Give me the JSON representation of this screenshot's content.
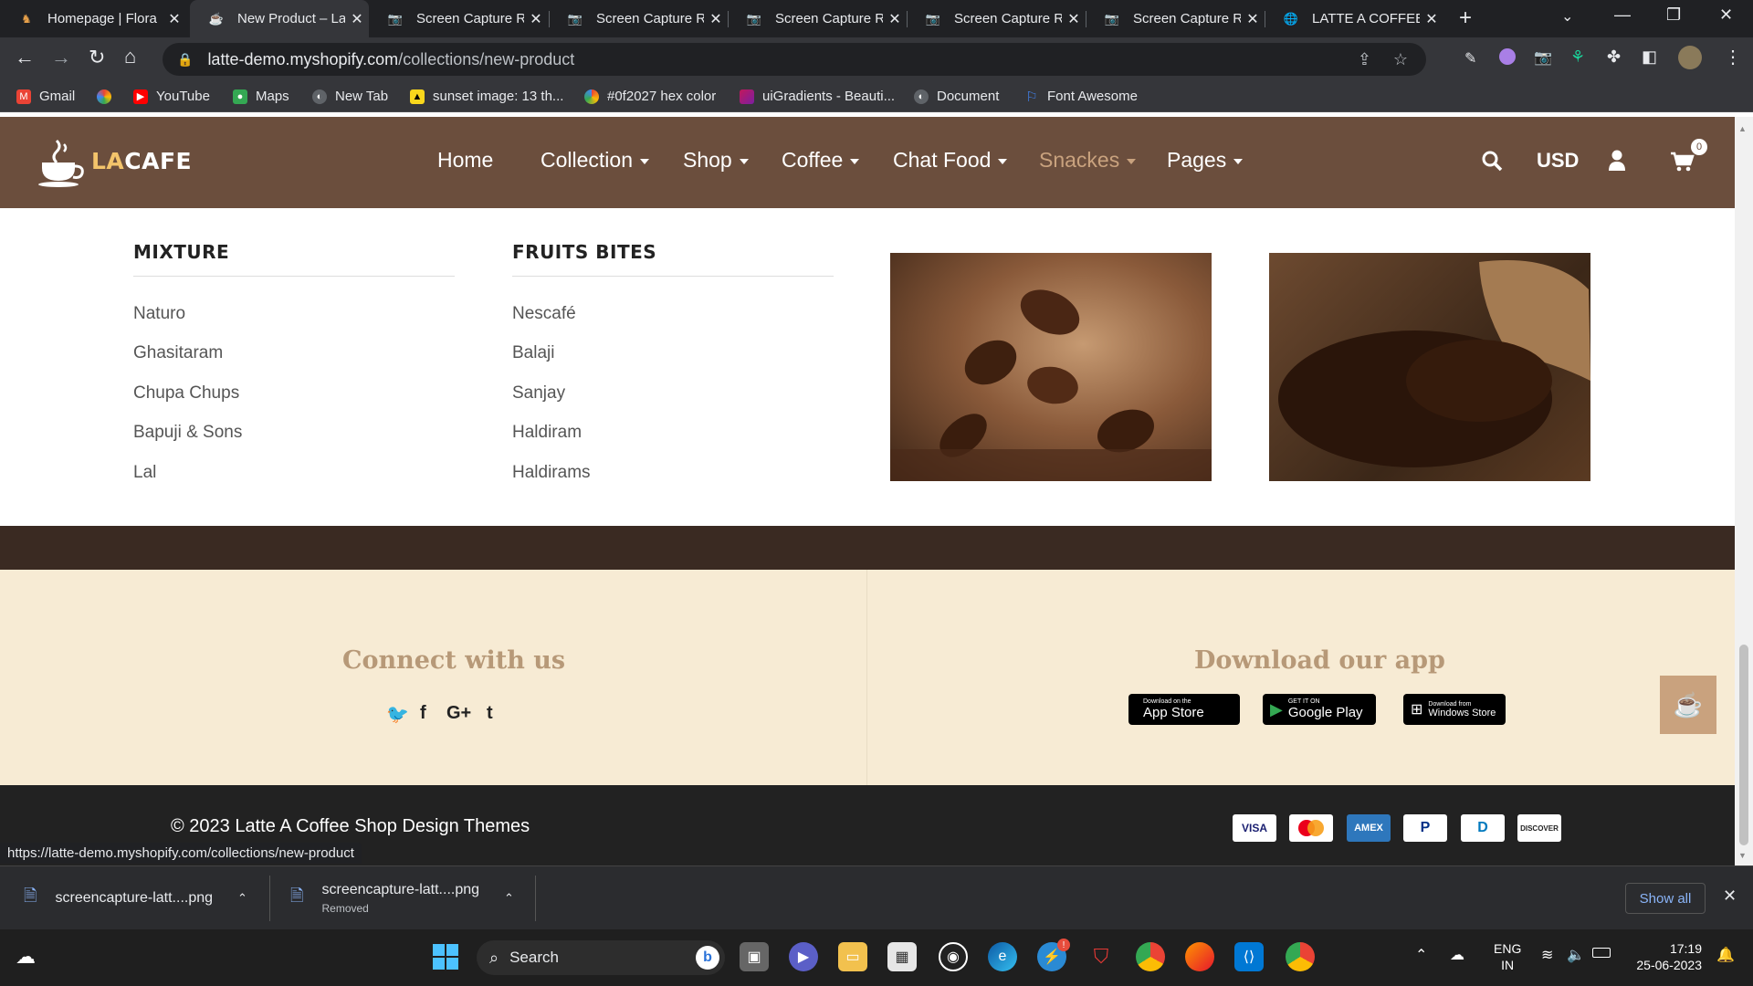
{
  "browser": {
    "tabs": [
      {
        "title": "Homepage | Flora",
        "active": false
      },
      {
        "title": "New Product – Latte",
        "active": true
      },
      {
        "title": "Screen Capture R",
        "active": false
      },
      {
        "title": "Screen Capture R",
        "active": false
      },
      {
        "title": "Screen Capture R",
        "active": false
      },
      {
        "title": "Screen Capture R",
        "active": false
      },
      {
        "title": "Screen Capture R",
        "active": false
      },
      {
        "title": "LATTE A COFFEE S",
        "active": false
      }
    ],
    "url_domain": "latte-demo.myshopify.com",
    "url_path": "/collections/new-product",
    "bookmarks": [
      {
        "label": "Gmail",
        "icon": "gmail-icon",
        "color": "#ea4335"
      },
      {
        "label": "",
        "icon": "colorful-circle-icon",
        "color": "#f4b400"
      },
      {
        "label": "YouTube",
        "icon": "youtube-icon",
        "color": "#ff0000"
      },
      {
        "label": "Maps",
        "icon": "maps-pin-icon",
        "color": "#34a853"
      },
      {
        "label": "New Tab",
        "icon": "globe-icon",
        "color": "#9aa0a6"
      },
      {
        "label": "sunset image: 13 th...",
        "icon": "image-icon",
        "color": "#f9d71c"
      },
      {
        "label": "#0f2027 hex color",
        "icon": "color-icon",
        "color": "#4285f4"
      },
      {
        "label": "uiGradients - Beauti...",
        "icon": "gradient-icon",
        "color": "#c2185b"
      },
      {
        "label": "Document",
        "icon": "globe-icon",
        "color": "#9aa0a6"
      },
      {
        "label": "Font Awesome",
        "icon": "flag-icon",
        "color": "#4285f4"
      }
    ],
    "status_url": "https://latte-demo.myshopify.com/collections/new-product"
  },
  "site": {
    "logo_text_1": "LA",
    "logo_text_2": "CAFE",
    "nav": [
      {
        "label": "Home",
        "dropdown": false,
        "active": false
      },
      {
        "label": "Collection",
        "dropdown": true,
        "active": false
      },
      {
        "label": "Shop",
        "dropdown": true,
        "active": false
      },
      {
        "label": "Coffee",
        "dropdown": true,
        "active": false
      },
      {
        "label": "Chat Food",
        "dropdown": true,
        "active": false
      },
      {
        "label": "Snackes",
        "dropdown": true,
        "active": true
      },
      {
        "label": "Pages",
        "dropdown": true,
        "active": false
      }
    ],
    "currency": "USD",
    "cart_count": "0",
    "colors": {
      "nav_bg": "#6b4e3d",
      "active_nav": "#c9a27e",
      "cream": "#f7ebd4",
      "heading": "#b79978",
      "footer": "#222222"
    },
    "mega_menu": {
      "columns": [
        {
          "heading": "MIXTURE",
          "links": [
            "Naturo",
            "Ghasitaram",
            "Chupa Chups",
            "Bapuji & Sons",
            "Lal"
          ]
        },
        {
          "heading": "FRUITS BITES",
          "links": [
            "Nescafé",
            "Balaji",
            "Sanjay",
            "Haldiram",
            "Haldirams"
          ]
        }
      ]
    },
    "connect": {
      "heading": "Connect with us",
      "icons": [
        "twitter-icon",
        "facebook-icon",
        "google-plus-icon",
        "tumblr-icon"
      ]
    },
    "app": {
      "heading": "Download our app",
      "stores": [
        {
          "small": "Download on the",
          "big": "App Store",
          "icon": "apple-icon"
        },
        {
          "small": "GET IT ON",
          "big": "Google Play",
          "icon": "google-play-icon"
        },
        {
          "small": "Download from",
          "big": "Windows Store",
          "icon": "windows-icon"
        }
      ]
    },
    "copyright": "© 2023 Latte A Coffee Shop Design Themes",
    "payments": [
      "VISA",
      "",
      "AMEX",
      "P",
      "D",
      "DISCOVER"
    ]
  },
  "downloads": [
    {
      "name": "screencapture-latt....png",
      "sub": ""
    },
    {
      "name": "screencapture-latt....png",
      "sub": "Removed"
    }
  ],
  "downloads_show_all": "Show all",
  "taskbar": {
    "search_placeholder": "Search",
    "lang_1": "ENG",
    "lang_2": "IN",
    "time": "17:19",
    "date": "25-06-2023"
  }
}
